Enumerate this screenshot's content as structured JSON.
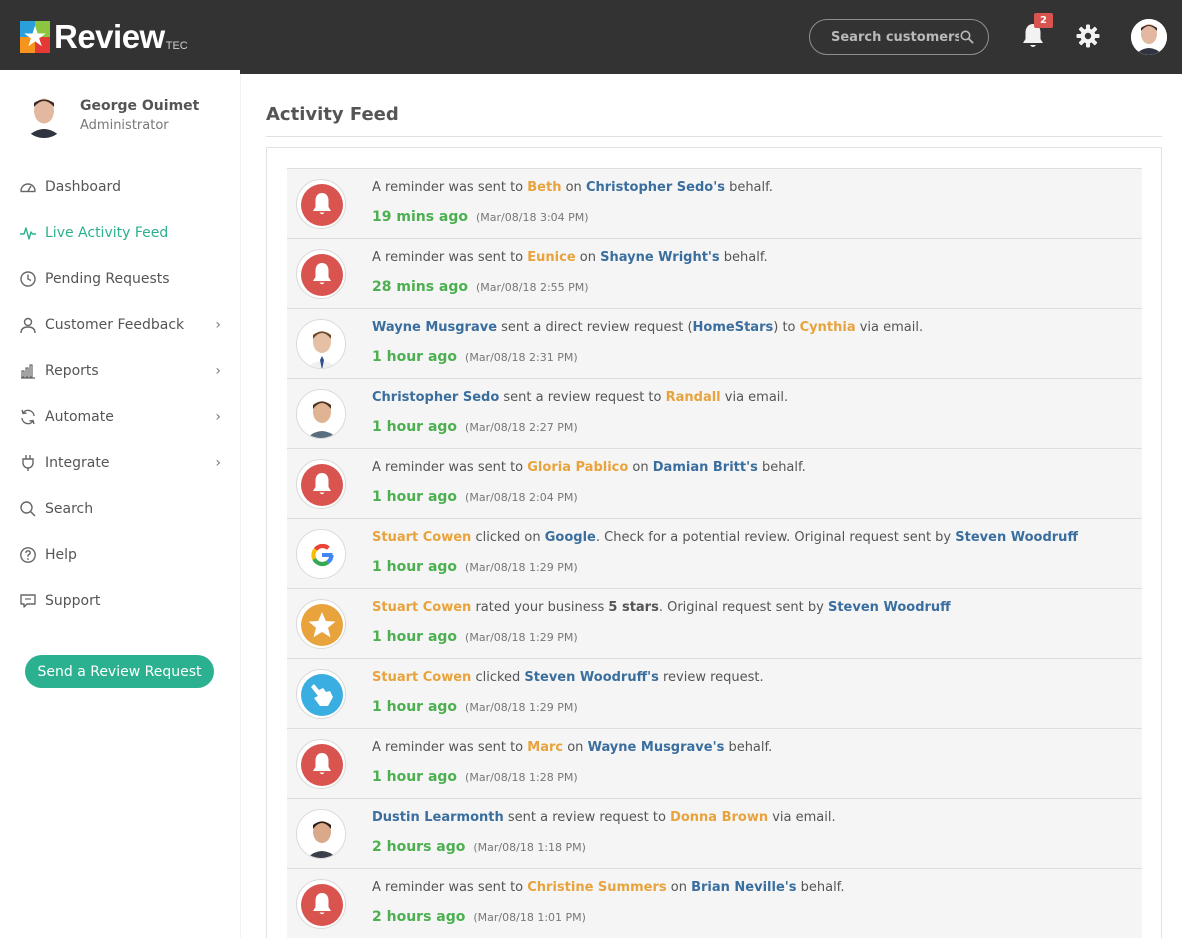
{
  "app": {
    "logo_text": "Review",
    "logo_sub": "TEC",
    "search_placeholder": "Search customers",
    "notifications_count": "2"
  },
  "user": {
    "name": "George Ouimet",
    "role": "Administrator"
  },
  "nav": [
    {
      "label": "Dashboard",
      "icon": "dashboard-icon",
      "active": false,
      "has_children": false
    },
    {
      "label": "Live Activity Feed",
      "icon": "activity-pulse-icon",
      "active": true,
      "has_children": false
    },
    {
      "label": "Pending Requests",
      "icon": "clock-icon",
      "active": false,
      "has_children": false
    },
    {
      "label": "Customer Feedback",
      "icon": "user-icon",
      "active": false,
      "has_children": true
    },
    {
      "label": "Reports",
      "icon": "bar-chart-icon",
      "active": false,
      "has_children": true
    },
    {
      "label": "Automate",
      "icon": "refresh-icon",
      "active": false,
      "has_children": true
    },
    {
      "label": "Integrate",
      "icon": "plug-icon",
      "active": false,
      "has_children": true
    },
    {
      "label": "Search",
      "icon": "search-icon",
      "active": false,
      "has_children": false
    },
    {
      "label": "Help",
      "icon": "help-icon",
      "active": false,
      "has_children": false
    },
    {
      "label": "Support",
      "icon": "chat-icon",
      "active": false,
      "has_children": false
    }
  ],
  "cta_label": "Send a Review Request",
  "page_title": "Activity Feed",
  "colors": {
    "topbar": "#333333",
    "accent_green": "#2bb18f",
    "link_blue": "#3a6e9e",
    "link_orange": "#e8a33d",
    "time_green": "#4caf50",
    "reminder_red": "#d9534f",
    "star_gold": "#e8a33d",
    "click_blue": "#3aaee0"
  },
  "feed": [
    {
      "icon": "bell",
      "ago": "19 mins ago",
      "stamp": "(Mar/08/18 3:04 PM)",
      "parts": [
        {
          "t": "A reminder was sent to ",
          "s": ""
        },
        {
          "t": "Beth",
          "s": "o"
        },
        {
          "t": " on ",
          "s": ""
        },
        {
          "t": "Christopher Sedo's",
          "s": "b"
        },
        {
          "t": " behalf.",
          "s": ""
        }
      ]
    },
    {
      "icon": "bell",
      "ago": "28 mins ago",
      "stamp": "(Mar/08/18 2:55 PM)",
      "parts": [
        {
          "t": "A reminder was sent to ",
          "s": ""
        },
        {
          "t": "Eunice",
          "s": "o"
        },
        {
          "t": " on ",
          "s": ""
        },
        {
          "t": "Shayne Wright's",
          "s": "b"
        },
        {
          "t": " behalf.",
          "s": ""
        }
      ]
    },
    {
      "icon": "person-a",
      "ago": "1 hour ago",
      "stamp": "(Mar/08/18 2:31 PM)",
      "parts": [
        {
          "t": "Wayne Musgrave",
          "s": "b"
        },
        {
          "t": " sent a direct review request (",
          "s": ""
        },
        {
          "t": "HomeStars",
          "s": "b"
        },
        {
          "t": ") to ",
          "s": ""
        },
        {
          "t": "Cynthia",
          "s": "o"
        },
        {
          "t": " via email.",
          "s": ""
        }
      ]
    },
    {
      "icon": "person-b",
      "ago": "1 hour ago",
      "stamp": "(Mar/08/18 2:27 PM)",
      "parts": [
        {
          "t": "Christopher Sedo",
          "s": "b"
        },
        {
          "t": " sent a review request to ",
          "s": ""
        },
        {
          "t": "Randall",
          "s": "o"
        },
        {
          "t": " via email.",
          "s": ""
        }
      ]
    },
    {
      "icon": "bell",
      "ago": "1 hour ago",
      "stamp": "(Mar/08/18 2:04 PM)",
      "parts": [
        {
          "t": "A reminder was sent to ",
          "s": ""
        },
        {
          "t": "Gloria Pablico",
          "s": "o"
        },
        {
          "t": " on ",
          "s": ""
        },
        {
          "t": "Damian Britt's",
          "s": "b"
        },
        {
          "t": " behalf.",
          "s": ""
        }
      ]
    },
    {
      "icon": "google",
      "ago": "1 hour ago",
      "stamp": "(Mar/08/18 1:29 PM)",
      "parts": [
        {
          "t": "Stuart Cowen",
          "s": "o"
        },
        {
          "t": " clicked on ",
          "s": ""
        },
        {
          "t": "Google",
          "s": "b"
        },
        {
          "t": ". Check for a potential review. Original request sent by ",
          "s": ""
        },
        {
          "t": "Steven Woodruff",
          "s": "b"
        }
      ]
    },
    {
      "icon": "star",
      "ago": "1 hour ago",
      "stamp": "(Mar/08/18 1:29 PM)",
      "parts": [
        {
          "t": "Stuart Cowen",
          "s": "o"
        },
        {
          "t": " rated your business ",
          "s": ""
        },
        {
          "t": "5 stars",
          "s": "k"
        },
        {
          "t": ". Original request sent by ",
          "s": ""
        },
        {
          "t": "Steven Woodruff",
          "s": "b"
        }
      ]
    },
    {
      "icon": "click",
      "ago": "1 hour ago",
      "stamp": "(Mar/08/18 1:29 PM)",
      "parts": [
        {
          "t": "Stuart Cowen",
          "s": "o"
        },
        {
          "t": " clicked ",
          "s": ""
        },
        {
          "t": "Steven Woodruff's",
          "s": "b"
        },
        {
          "t": " review request.",
          "s": ""
        }
      ]
    },
    {
      "icon": "bell",
      "ago": "1 hour ago",
      "stamp": "(Mar/08/18 1:28 PM)",
      "parts": [
        {
          "t": "A reminder was sent to ",
          "s": ""
        },
        {
          "t": "Marc",
          "s": "o"
        },
        {
          "t": " on ",
          "s": ""
        },
        {
          "t": "Wayne Musgrave's",
          "s": "b"
        },
        {
          "t": " behalf.",
          "s": ""
        }
      ]
    },
    {
      "icon": "person-c",
      "ago": "2 hours ago",
      "stamp": "(Mar/08/18 1:18 PM)",
      "parts": [
        {
          "t": "Dustin Learmonth",
          "s": "b"
        },
        {
          "t": " sent a review request to ",
          "s": ""
        },
        {
          "t": "Donna Brown",
          "s": "o"
        },
        {
          "t": " via email.",
          "s": ""
        }
      ]
    },
    {
      "icon": "bell",
      "ago": "2 hours ago",
      "stamp": "(Mar/08/18 1:01 PM)",
      "parts": [
        {
          "t": "A reminder was sent to ",
          "s": ""
        },
        {
          "t": "Christine Summers",
          "s": "o"
        },
        {
          "t": " on ",
          "s": ""
        },
        {
          "t": "Brian Neville's",
          "s": "b"
        },
        {
          "t": " behalf.",
          "s": ""
        }
      ]
    }
  ]
}
